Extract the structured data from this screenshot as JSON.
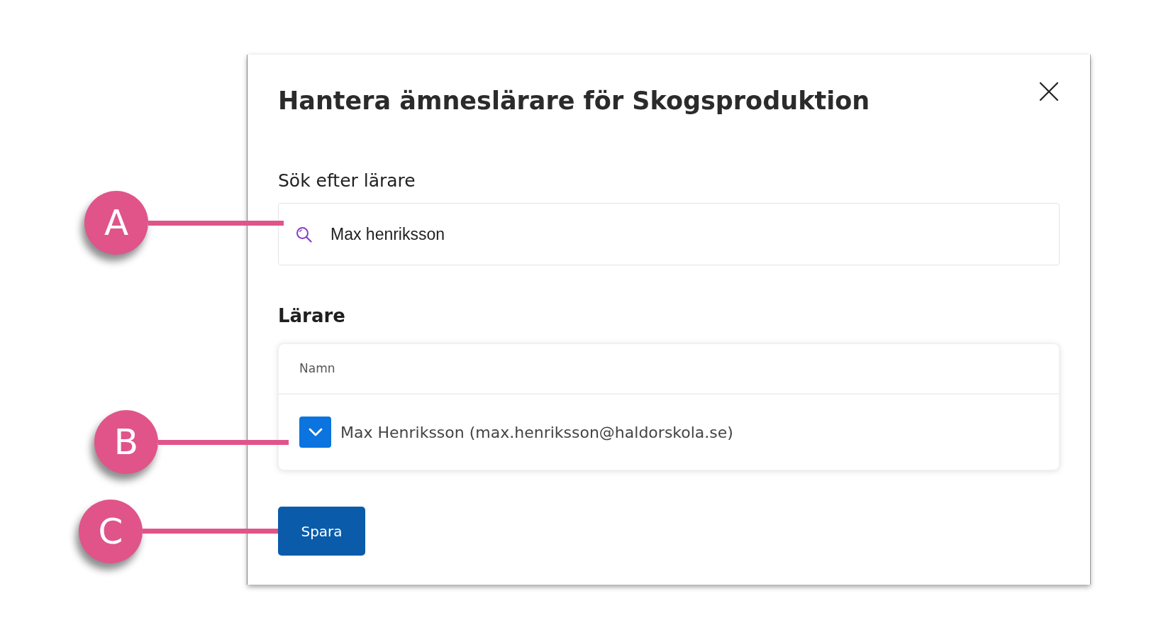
{
  "dialog": {
    "title": "Hantera ämneslärare för Skogsproduktion",
    "search": {
      "label": "Sök efter lärare",
      "value": "Max henriksson",
      "callout": "A"
    },
    "teachers": {
      "heading": "Lärare",
      "columns": [
        "Namn"
      ],
      "rows": [
        {
          "name": "Max Henriksson (max.henriksson@haldorskola.se)",
          "checked": true,
          "callout": "B"
        }
      ]
    },
    "save_button": {
      "label": "Spara",
      "callout": "C"
    }
  }
}
